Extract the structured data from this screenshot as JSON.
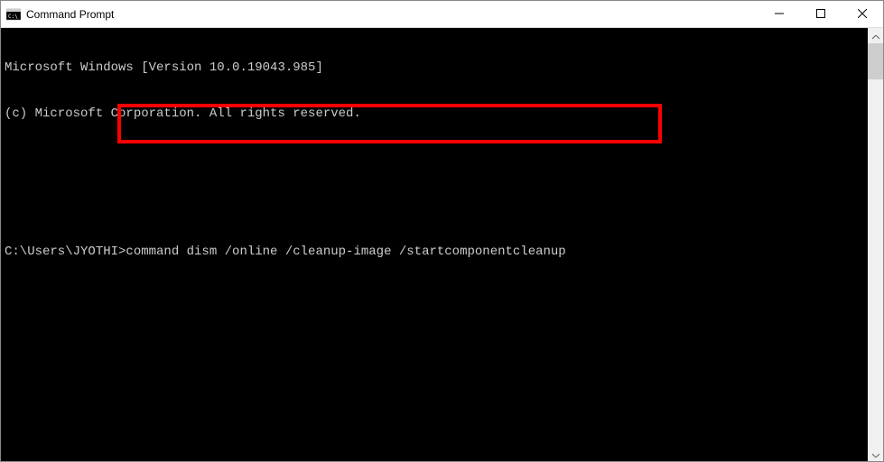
{
  "window": {
    "title": "Command Prompt"
  },
  "terminal": {
    "line1": "Microsoft Windows [Version 10.0.19043.985]",
    "line2": "(c) Microsoft Corporation. All rights reserved.",
    "blank": "",
    "prompt": "C:\\Users\\JYOTHI>",
    "command": "command dism /online /cleanup-image /startcomponentcleanup"
  },
  "icons": {
    "app": "cmd-icon",
    "minimize": "minimize-icon",
    "maximize": "maximize-icon",
    "close": "close-icon",
    "scroll_up": "chevron-up-icon",
    "scroll_down": "chevron-down-icon"
  }
}
